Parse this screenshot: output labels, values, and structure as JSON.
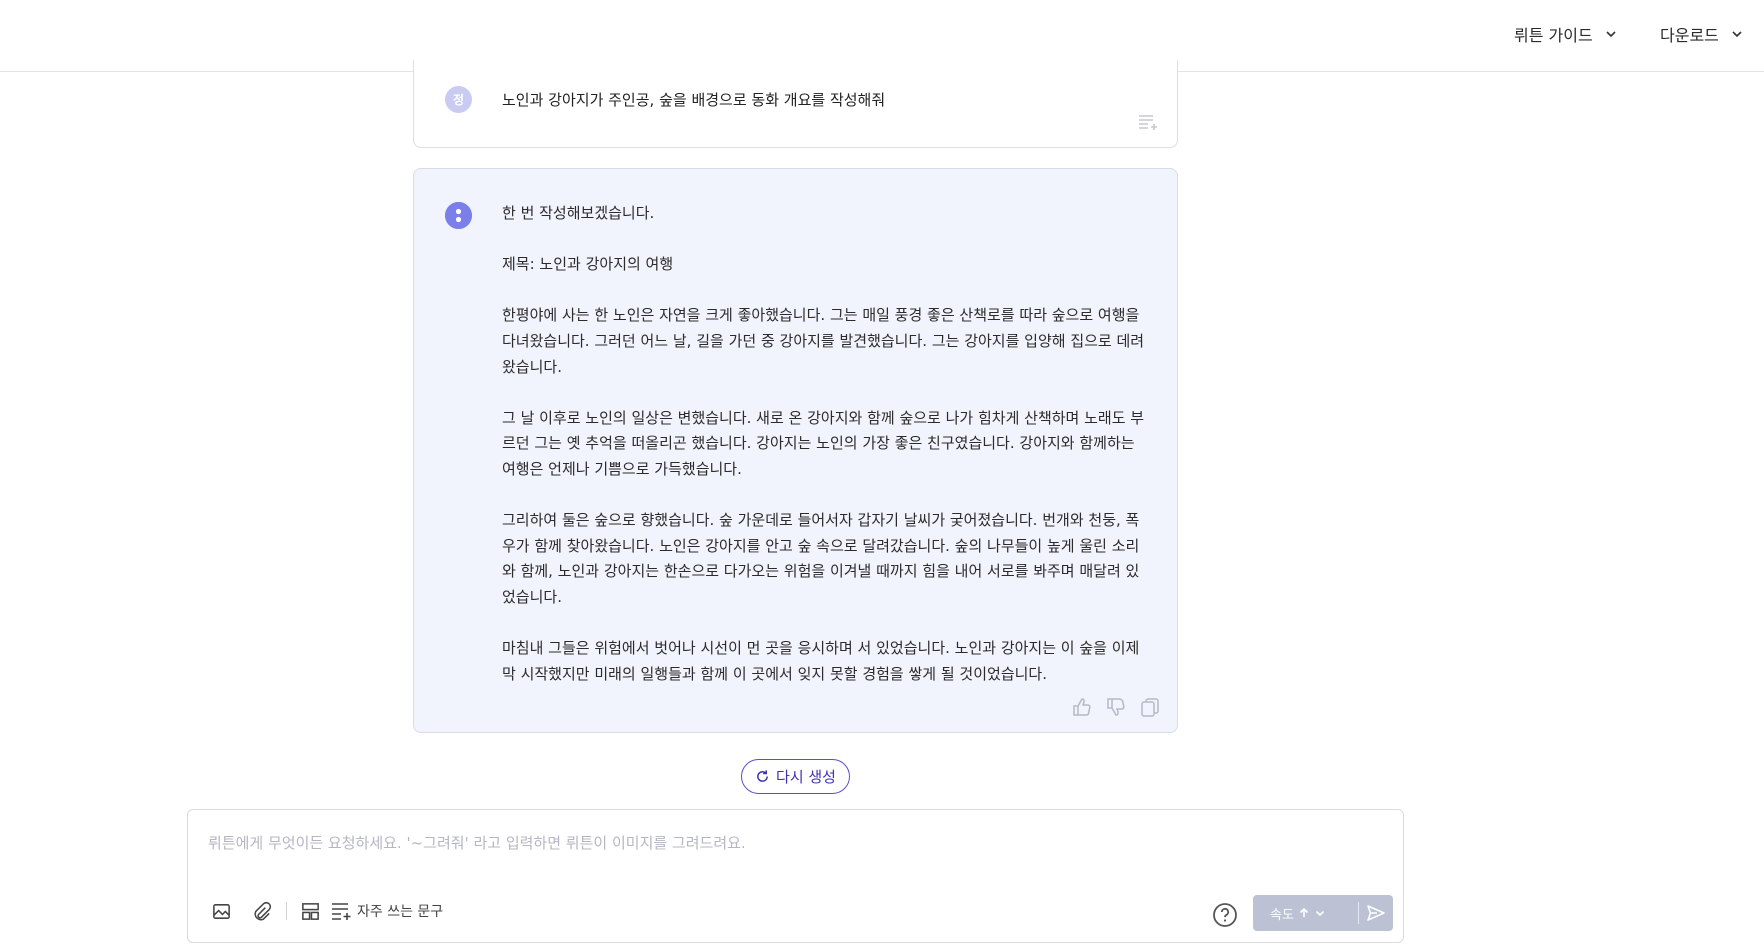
{
  "header": {
    "nav_guide": "뤼튼 가이드",
    "nav_download": "다운로드"
  },
  "conversation": {
    "user": {
      "avatar_initial": "정",
      "message": "노인과 강아지가 주인공, 숲을 배경으로 동화 개요를 작성해줘"
    },
    "assistant": {
      "paragraphs": [
        "한 번 작성해보겠습니다.",
        "제목: 노인과 강아지의 여행",
        "한평야에 사는 한 노인은 자연을 크게 좋아했습니다. 그는 매일 풍경 좋은 산책로를 따라 숲으로 여행을 다녀왔습니다. 그러던 어느 날, 길을 가던 중 강아지를 발견했습니다. 그는 강아지를 입양해 집으로 데려왔습니다.",
        "그 날 이후로 노인의 일상은 변했습니다. 새로 온 강아지와 함께 숲으로 나가 힘차게 산책하며 노래도 부르던 그는 옛 추억을 떠올리곤 했습니다. 강아지는 노인의 가장 좋은 친구였습니다. 강아지와 함께하는 여행은 언제나 기쁨으로 가득했습니다.",
        "그리하여 둘은 숲으로 향했습니다. 숲 가운데로 들어서자 갑자기 날씨가 궂어졌습니다. 번개와 천둥, 폭우가 함께 찾아왔습니다. 노인은 강아지를 안고 숲 속으로 달려갔습니다. 숲의 나무들이 높게 울린 소리와 함께, 노인과 강아지는 한손으로 다가오는 위험을 이겨낼 때까지 힘을 내어 서로를 봐주며 매달려 있었습니다.",
        "마침내 그들은 위험에서 벗어나 시선이 먼 곳을 응시하며 서 있었습니다. 노인과 강아지는 이 숲을 이제 막 시작했지만 미래의 일행들과 함께 이 곳에서 잊지 못할 경험을 쌓게 될 것이었습니다."
      ]
    }
  },
  "regenerate_label": "다시 생성",
  "composer": {
    "placeholder": "뤼튼에게 무엇이든 요청하세요.  '~그려줘' 라고 입력하면 뤼튼이 이미지를 그려드려요.",
    "frequent_phrases_label": "자주 쓰는 문구",
    "speed_label": "속도"
  },
  "colors": {
    "accent": "#5a4fcf",
    "bot_bubble": "#f1f4fc",
    "send_disabled": "#bcc2d4"
  },
  "icons": [
    "chevron-down-icon",
    "add-prompt-icon",
    "thumbs-up-icon",
    "thumbs-down-icon",
    "copy-icon",
    "refresh-icon",
    "image-icon",
    "paperclip-icon",
    "template-icon",
    "list-add-icon",
    "help-icon",
    "arrow-up-icon",
    "send-icon"
  ]
}
